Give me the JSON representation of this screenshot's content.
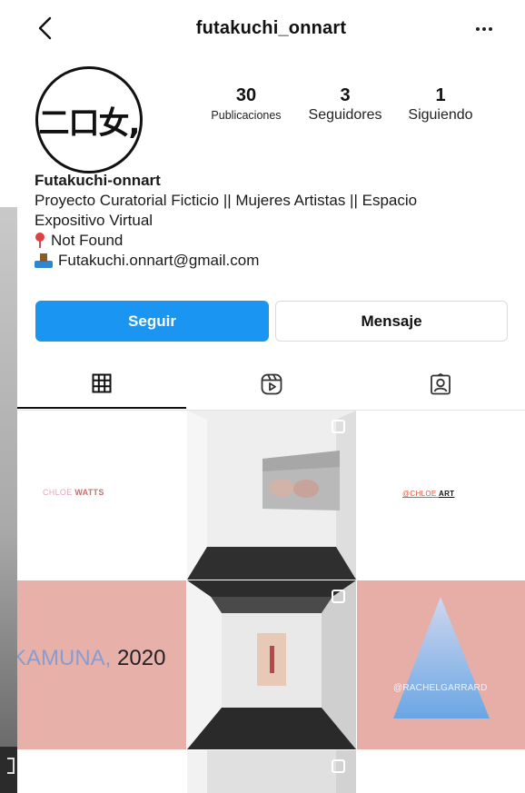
{
  "header": {
    "username": "futakuchi_onnart"
  },
  "profile": {
    "avatar_text": "二口女,",
    "stats": [
      {
        "count": "30",
        "label": "Publicaciones"
      },
      {
        "count": "3",
        "label": "Seguidores"
      },
      {
        "count": "1",
        "label": "Siguiendo"
      }
    ]
  },
  "bio": {
    "name": "Futakuchi-onnart",
    "description_line1": "Proyecto Curatorial Ficticio || Mujeres Artistas || Espacio",
    "description_line2": "Expositivo Virtual",
    "location": "Not Found",
    "email": "Futakuchi.onnart@gmail.com"
  },
  "actions": {
    "follow_label": "Seguir",
    "message_label": "Mensaje"
  },
  "tabs": [
    {
      "icon": "grid-icon"
    },
    {
      "icon": "reels-icon"
    },
    {
      "icon": "tagged-icon"
    }
  ],
  "grid": {
    "post1": {
      "part1": "CHLOE",
      "part2": "WATTS"
    },
    "post3": {
      "part1": "@CHLOE",
      "part2": "ART"
    },
    "post4": {
      "part1": "KAMUNA,",
      "part2": "2020"
    },
    "post6": {
      "label": "@RACHELGARRARD"
    }
  },
  "colors": {
    "follow_button": "#1a95f2",
    "pink_tile": "#e7b1a9"
  }
}
